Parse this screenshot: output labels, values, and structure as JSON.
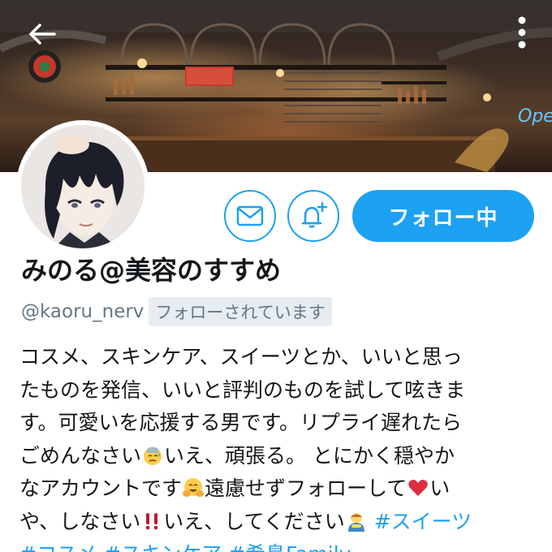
{
  "header": {
    "back_icon": "arrow-left-icon",
    "more_icon": "more-vertical-icon"
  },
  "profile": {
    "display_name": "みのる@美容のすすめ",
    "handle": "@kaoru_nerv",
    "follows_you": "フォローされています"
  },
  "actions": {
    "message_icon": "envelope-icon",
    "notify_icon": "bell-plus-icon",
    "follow_label": "フォロー中"
  },
  "bio": {
    "line1": "コスメ、スキンケア、スイーツとか、いいと思っ",
    "line2": "たものを発信、いいと評判のものを試して呟きま",
    "line3": "す。可愛いを応援する男です。リプライ遅れたら",
    "line4a": "ごめんなさい",
    "line4b": "いえ、頑張る。 とにかく穏やか",
    "line5a": "なアカウントです",
    "line5b": "遠慮せずフォローして",
    "line5c": "い",
    "line6a": "や、しなさい",
    "line6b": "いえ、してください",
    "hashtag1": "#スイーツ",
    "hashtag2": "#コスメ",
    "hashtag3": "#スキンケア",
    "hashtag4": "#希島Family",
    "emojis": [
      "sweat-face-icon",
      "hugging-face-icon",
      "red-heart-icon",
      "double-exclamation-icon",
      "man-bowing-icon"
    ]
  },
  "colors": {
    "accent": "#1da1f2",
    "secondary_text": "#657786",
    "badge_bg": "#e6ecf0"
  }
}
